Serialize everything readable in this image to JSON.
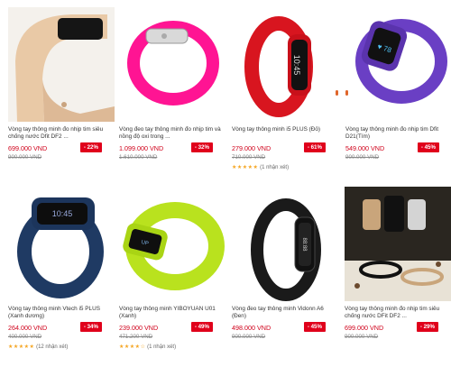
{
  "products": [
    {
      "title": "Vòng tay thông minh đo nhịp tim siêu chống nước Dfit DF2 ...",
      "price": "699.000 VND",
      "old_price": "900.000 VND",
      "discount": "- 22%",
      "rating": "",
      "reviews": ""
    },
    {
      "title": "Vòng đeo tay thông minh đo nhịp tim và nồng độ oxi trong ...",
      "price": "1.099.000 VND",
      "old_price": "1.610.000 VND",
      "discount": "- 32%",
      "rating": "",
      "reviews": ""
    },
    {
      "title": "Vòng tay thông minh i5 PLUS (Đỏ)",
      "price": "279.000 VND",
      "old_price": "710.000 VND",
      "discount": "- 61%",
      "rating": "★★★★★",
      "reviews": "(1 nhận xét)"
    },
    {
      "title": "Vòng tay thông minh đo nhịp tim Dfit D21(Tím)",
      "price": "549.000 VND",
      "old_price": "900.000 VND",
      "discount": "- 45%",
      "rating": "",
      "reviews": ""
    },
    {
      "title": "Vòng tay thông minh Vtech i5 PLUS (Xanh dương)",
      "price": "264.000 VND",
      "old_price": "400.000 VND",
      "discount": "- 34%",
      "rating": "★★★★★",
      "reviews": "(12 nhận xét)"
    },
    {
      "title": "Vòng tay thông minh YIBOYUAN U01 (Xanh)",
      "price": "239.000 VND",
      "old_price": "471.200 VND",
      "discount": "- 49%",
      "rating": "★★★★☆",
      "reviews": "(1 nhận xét)"
    },
    {
      "title": "Vòng đeo tay thông minh Vidonn A6 (Đen)",
      "price": "498.000 VND",
      "old_price": "900.000 VND",
      "discount": "- 45%",
      "rating": "",
      "reviews": ""
    },
    {
      "title": "Vòng tay thông minh đo nhịp tim siêu chống nước DFit DF2 ...",
      "price": "699.000 VND",
      "old_price": "900.000 VND",
      "discount": "- 29%",
      "rating": "",
      "reviews": ""
    }
  ],
  "colors": {
    "price": "#d0021b",
    "badge": "#e0001b",
    "stars": "#f5a623"
  }
}
